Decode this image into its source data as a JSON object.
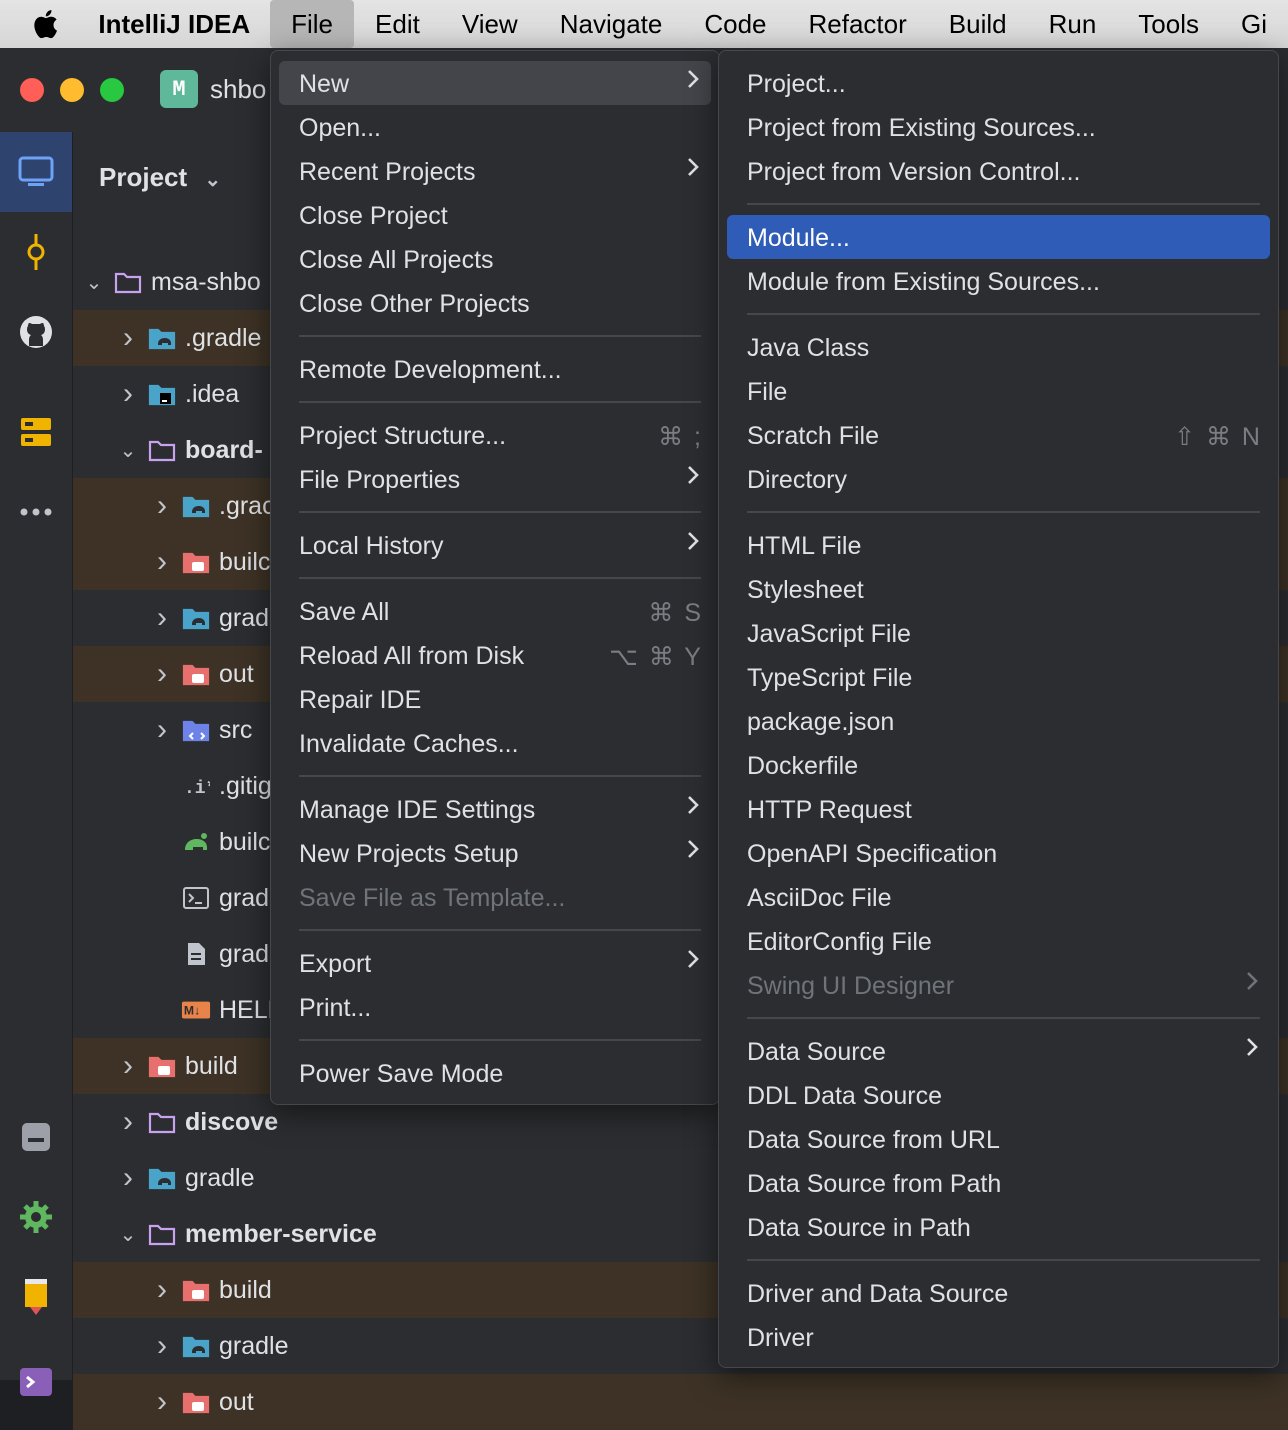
{
  "menubar": {
    "app": "IntelliJ IDEA",
    "items": [
      "File",
      "Edit",
      "View",
      "Navigate",
      "Code",
      "Refactor",
      "Build",
      "Run",
      "Tools",
      "Gi"
    ],
    "active_index": 0
  },
  "window": {
    "project_badge": "M",
    "project_name": "shbo"
  },
  "project_panel": {
    "title": "Project",
    "tree": [
      {
        "name": "msa-shbo",
        "indent": 0,
        "chev": "down",
        "icon": "folder-icon",
        "excluded": false
      },
      {
        "name": ".gradle",
        "indent": 1,
        "chev": "right",
        "icon": "gradle-folder-icon",
        "excluded": true
      },
      {
        "name": ".idea",
        "indent": 1,
        "chev": "right",
        "icon": "idea-folder-icon",
        "excluded": false
      },
      {
        "name": "board-",
        "indent": 1,
        "chev": "down",
        "icon": "folder-icon",
        "excluded": false,
        "bold": true
      },
      {
        "name": ".grac",
        "indent": 2,
        "chev": "right",
        "icon": "gradle-folder-icon",
        "excluded": true
      },
      {
        "name": "builc",
        "indent": 2,
        "chev": "right",
        "icon": "excluded-folder-icon",
        "excluded": true
      },
      {
        "name": "grad",
        "indent": 2,
        "chev": "right",
        "icon": "gradle-folder-icon",
        "excluded": false
      },
      {
        "name": "out",
        "indent": 2,
        "chev": "right",
        "icon": "excluded-folder-icon",
        "excluded": true
      },
      {
        "name": "src",
        "indent": 2,
        "chev": "right",
        "icon": "source-folder-icon",
        "excluded": false
      },
      {
        "name": ".gitig",
        "indent": 2,
        "chev": "",
        "icon": "gitignore-icon",
        "excluded": false
      },
      {
        "name": "builc",
        "indent": 2,
        "chev": "",
        "icon": "gradle-file-icon",
        "excluded": false
      },
      {
        "name": "grad",
        "indent": 2,
        "chev": "",
        "icon": "terminal-file-icon",
        "excluded": false
      },
      {
        "name": "grad",
        "indent": 2,
        "chev": "",
        "icon": "text-file-icon",
        "excluded": false
      },
      {
        "name": "HELF",
        "indent": 2,
        "chev": "",
        "icon": "markdown-icon",
        "excluded": false
      },
      {
        "name": "build",
        "indent": 1,
        "chev": "right",
        "icon": "excluded-folder-icon",
        "excluded": true
      },
      {
        "name": "discove",
        "indent": 1,
        "chev": "right",
        "icon": "folder-icon",
        "excluded": false,
        "bold": true
      },
      {
        "name": "gradle",
        "indent": 1,
        "chev": "right",
        "icon": "gradle-folder-icon",
        "excluded": false
      },
      {
        "name": "member-service",
        "indent": 1,
        "chev": "down",
        "icon": "folder-icon",
        "excluded": false,
        "bold": true
      },
      {
        "name": "build",
        "indent": 2,
        "chev": "right",
        "icon": "excluded-folder-icon",
        "excluded": true
      },
      {
        "name": "gradle",
        "indent": 2,
        "chev": "right",
        "icon": "gradle-folder-icon",
        "excluded": false
      },
      {
        "name": "out",
        "indent": 2,
        "chev": "right",
        "icon": "excluded-folder-icon",
        "excluded": true
      }
    ]
  },
  "file_menu": {
    "items": [
      {
        "label": "New",
        "submenu": true,
        "state": "hover"
      },
      {
        "label": "Open..."
      },
      {
        "label": "Recent Projects",
        "submenu": true
      },
      {
        "label": "Close Project"
      },
      {
        "label": "Close All Projects"
      },
      {
        "label": "Close Other Projects"
      },
      {
        "sep": true
      },
      {
        "label": "Remote Development..."
      },
      {
        "sep": true
      },
      {
        "label": "Project Structure...",
        "shortcut": "⌘ ;"
      },
      {
        "label": "File Properties",
        "submenu": true
      },
      {
        "sep": true
      },
      {
        "label": "Local History",
        "submenu": true
      },
      {
        "sep": true
      },
      {
        "label": "Save All",
        "shortcut": "⌘ S"
      },
      {
        "label": "Reload All from Disk",
        "shortcut": "⌥ ⌘ Y"
      },
      {
        "label": "Repair IDE"
      },
      {
        "label": "Invalidate Caches..."
      },
      {
        "sep": true
      },
      {
        "label": "Manage IDE Settings",
        "submenu": true
      },
      {
        "label": "New Projects Setup",
        "submenu": true
      },
      {
        "label": "Save File as Template...",
        "state": "disabled"
      },
      {
        "sep": true
      },
      {
        "label": "Export",
        "submenu": true
      },
      {
        "label": "Print..."
      },
      {
        "sep": true
      },
      {
        "label": "Power Save Mode"
      }
    ]
  },
  "new_menu": {
    "items": [
      {
        "label": "Project..."
      },
      {
        "label": "Project from Existing Sources..."
      },
      {
        "label": "Project from Version Control..."
      },
      {
        "sep": true
      },
      {
        "label": "Module...",
        "state": "selected"
      },
      {
        "label": "Module from Existing Sources..."
      },
      {
        "sep": true
      },
      {
        "label": "Java Class"
      },
      {
        "label": "File"
      },
      {
        "label": "Scratch File",
        "shortcut": "⇧ ⌘ N"
      },
      {
        "label": "Directory"
      },
      {
        "sep": true
      },
      {
        "label": "HTML File"
      },
      {
        "label": "Stylesheet"
      },
      {
        "label": "JavaScript File"
      },
      {
        "label": "TypeScript File"
      },
      {
        "label": "package.json"
      },
      {
        "label": "Dockerfile"
      },
      {
        "label": "HTTP Request"
      },
      {
        "label": "OpenAPI Specification"
      },
      {
        "label": "AsciiDoc File"
      },
      {
        "label": "EditorConfig File"
      },
      {
        "label": "Swing UI Designer",
        "submenu": true,
        "state": "disabled"
      },
      {
        "sep": true
      },
      {
        "label": "Data Source",
        "submenu": true
      },
      {
        "label": "DDL Data Source"
      },
      {
        "label": "Data Source from URL"
      },
      {
        "label": "Data Source from Path"
      },
      {
        "label": "Data Source in Path"
      },
      {
        "sep": true
      },
      {
        "label": "Driver and Data Source"
      },
      {
        "label": "Driver"
      }
    ]
  },
  "colors": {
    "selection": "#2f5cb6",
    "hover": "#43454a",
    "excluded_row": "#3d3225",
    "disabled_text": "#6f737a"
  }
}
